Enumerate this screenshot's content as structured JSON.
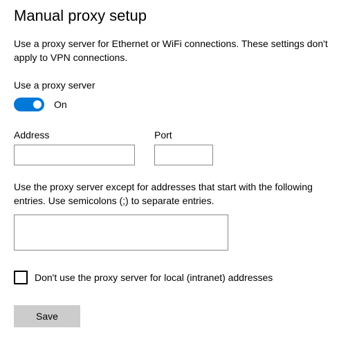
{
  "heading": "Manual proxy setup",
  "description": "Use a proxy server for Ethernet or WiFi connections. These settings don't apply to VPN connections.",
  "useProxyLabel": "Use a proxy server",
  "toggle": {
    "state": "On",
    "on": true
  },
  "fields": {
    "addressLabel": "Address",
    "addressValue": "",
    "portLabel": "Port",
    "portValue": ""
  },
  "exceptionsText": "Use the proxy server except for addresses that start with the following entries. Use semicolons (;) to separate entries.",
  "exceptionsValue": "",
  "checkbox": {
    "checked": false,
    "label": "Don't use the proxy server for local (intranet) addresses"
  },
  "saveLabel": "Save"
}
